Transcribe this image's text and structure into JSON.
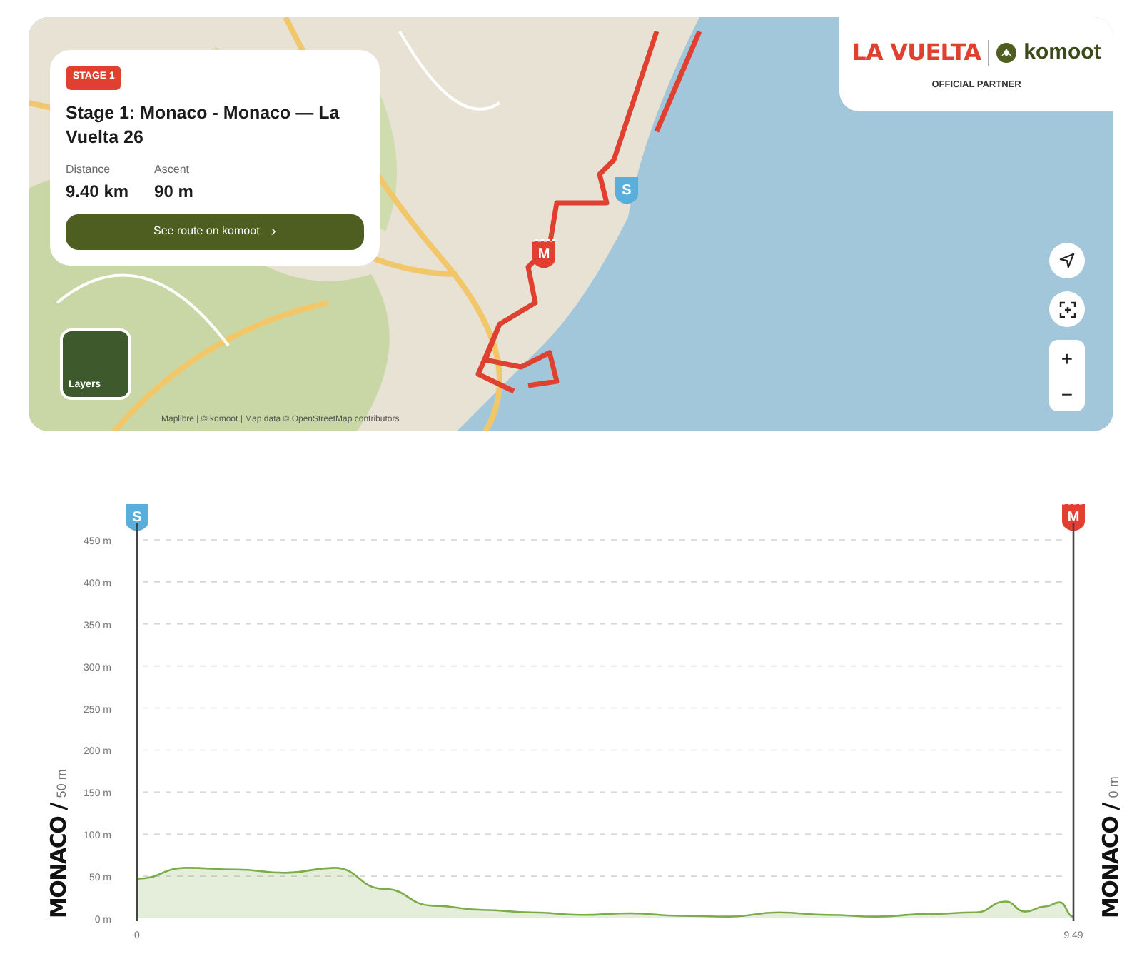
{
  "stage_card": {
    "badge": "STAGE 1",
    "title": "Stage 1: Monaco - Monaco — La Vuelta 26",
    "stats": [
      {
        "label": "Distance",
        "value": "9.40 km"
      },
      {
        "label": "Ascent",
        "value": "90 m"
      }
    ],
    "button": "See route on komoot",
    "button_arrow": "›"
  },
  "partner": {
    "brand": "LA VUELTA",
    "partner_name": "komoot",
    "caption": "OFFICIAL PARTNER"
  },
  "map": {
    "start_marker": "S",
    "finish_marker": "M",
    "layers_label": "Layers",
    "attribution": "Maplibre | © komoot | Map data © OpenStreetMap contributors",
    "zoom_in": "+",
    "zoom_out": "−"
  },
  "profile": {
    "start_marker": "S",
    "finish_marker": "M",
    "start_place": "MONACO /",
    "start_altitude": "50 m",
    "finish_place": "MONACO /",
    "finish_altitude": "0 m",
    "chart_data": {
      "type": "area",
      "x": [
        0,
        0.5,
        1,
        1.5,
        2,
        2.5,
        3,
        3.5,
        4,
        4.5,
        5,
        5.5,
        6,
        6.5,
        7,
        7.5,
        8,
        8.5,
        8.8,
        9,
        9.2,
        9.35,
        9.49
      ],
      "grid": true,
      "series": [
        {
          "color": "#7cab4a",
          "values": [
            47,
            60,
            58,
            54,
            60,
            35,
            15,
            10,
            7,
            4,
            6,
            3,
            2,
            7,
            4,
            2,
            5,
            7,
            20,
            8,
            14,
            19,
            2
          ]
        }
      ],
      "xlim": [
        0,
        9.49
      ],
      "ylim": [
        0,
        450
      ],
      "xticks": [
        0,
        9.49
      ],
      "yticks": [
        {
          "value": 0,
          "label": "0 m"
        },
        {
          "value": 50,
          "label": "50 m"
        },
        {
          "value": 100,
          "label": "100 m"
        },
        {
          "value": 150,
          "label": "150 m"
        },
        {
          "value": 200,
          "label": "200 m"
        },
        {
          "value": 250,
          "label": "250 m"
        },
        {
          "value": 300,
          "label": "300 m"
        },
        {
          "value": 350,
          "label": "350 m"
        },
        {
          "value": 400,
          "label": "400 m"
        },
        {
          "value": 450,
          "label": "450 m"
        }
      ]
    }
  }
}
